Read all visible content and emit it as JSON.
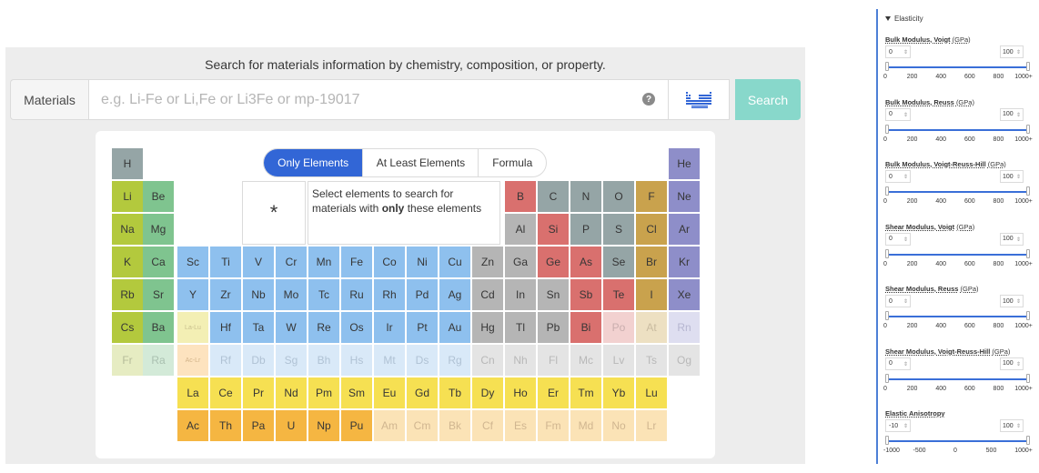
{
  "search": {
    "headline": "Search for materials information by chemistry, composition, or property.",
    "label": "Materials",
    "placeholder": "e.g. Li-Fe or Li,Fe or Li3Fe or mp-19017",
    "help": "?",
    "button": "Search",
    "periodic_table_icon": "periodic-table-icon"
  },
  "modes": [
    "Only Elements",
    "At Least Elements",
    "Formula"
  ],
  "active_mode": "Only Elements",
  "selection_box": {
    "wildcard": "*",
    "hint_prefix": "Select elements to search for materials with ",
    "hint_bold": "only",
    "hint_suffix": " these elements"
  },
  "colors": {
    "accent": "#3266d6",
    "search_button": "#88d8cb",
    "slider": "#3a6fd8"
  },
  "elements": [
    [
      "H",
      0,
      0,
      "#95a5a6",
      "#363636"
    ],
    [
      "He",
      17,
      0,
      "#8e8ec9",
      "#363636"
    ],
    [
      "Li",
      0,
      1,
      "#b3c93d",
      "#363636"
    ],
    [
      "Be",
      1,
      1,
      "#7fc48f",
      "#363636"
    ],
    [
      "B",
      12,
      1,
      "#d9706e",
      "#363636"
    ],
    [
      "C",
      13,
      1,
      "#95a5a6",
      "#363636"
    ],
    [
      "N",
      14,
      1,
      "#95a5a6",
      "#363636"
    ],
    [
      "O",
      15,
      1,
      "#95a5a6",
      "#363636"
    ],
    [
      "F",
      16,
      1,
      "#c9a24d",
      "#363636"
    ],
    [
      "Ne",
      17,
      1,
      "#8e8ec9",
      "#363636"
    ],
    [
      "Na",
      0,
      2,
      "#b3c93d",
      "#363636"
    ],
    [
      "Mg",
      1,
      2,
      "#7fc48f",
      "#363636"
    ],
    [
      "Al",
      12,
      2,
      "#b5b5b5",
      "#363636"
    ],
    [
      "Si",
      13,
      2,
      "#d9706e",
      "#363636"
    ],
    [
      "P",
      14,
      2,
      "#95a5a6",
      "#363636"
    ],
    [
      "S",
      15,
      2,
      "#95a5a6",
      "#363636"
    ],
    [
      "Cl",
      16,
      2,
      "#c9a24d",
      "#363636"
    ],
    [
      "Ar",
      17,
      2,
      "#8e8ec9",
      "#363636"
    ],
    [
      "K",
      0,
      3,
      "#b3c93d",
      "#363636"
    ],
    [
      "Ca",
      1,
      3,
      "#7fc48f",
      "#363636"
    ],
    [
      "Sc",
      2,
      3,
      "#8ec0ee",
      "#363636"
    ],
    [
      "Ti",
      3,
      3,
      "#8ec0ee",
      "#363636"
    ],
    [
      "V",
      4,
      3,
      "#8ec0ee",
      "#363636"
    ],
    [
      "Cr",
      5,
      3,
      "#8ec0ee",
      "#363636"
    ],
    [
      "Mn",
      6,
      3,
      "#8ec0ee",
      "#363636"
    ],
    [
      "Fe",
      7,
      3,
      "#8ec0ee",
      "#363636"
    ],
    [
      "Co",
      8,
      3,
      "#8ec0ee",
      "#363636"
    ],
    [
      "Ni",
      9,
      3,
      "#8ec0ee",
      "#363636"
    ],
    [
      "Cu",
      10,
      3,
      "#8ec0ee",
      "#363636"
    ],
    [
      "Zn",
      11,
      3,
      "#b5b5b5",
      "#363636"
    ],
    [
      "Ga",
      12,
      3,
      "#b5b5b5",
      "#363636"
    ],
    [
      "Ge",
      13,
      3,
      "#d9706e",
      "#363636"
    ],
    [
      "As",
      14,
      3,
      "#d9706e",
      "#363636"
    ],
    [
      "Se",
      15,
      3,
      "#95a5a6",
      "#363636"
    ],
    [
      "Br",
      16,
      3,
      "#c9a24d",
      "#363636"
    ],
    [
      "Kr",
      17,
      3,
      "#8e8ec9",
      "#363636"
    ],
    [
      "Rb",
      0,
      4,
      "#b3c93d",
      "#363636"
    ],
    [
      "Sr",
      1,
      4,
      "#7fc48f",
      "#363636"
    ],
    [
      "Y",
      2,
      4,
      "#8ec0ee",
      "#363636"
    ],
    [
      "Zr",
      3,
      4,
      "#8ec0ee",
      "#363636"
    ],
    [
      "Nb",
      4,
      4,
      "#8ec0ee",
      "#363636"
    ],
    [
      "Mo",
      5,
      4,
      "#8ec0ee",
      "#363636"
    ],
    [
      "Tc",
      6,
      4,
      "#8ec0ee",
      "#363636"
    ],
    [
      "Ru",
      7,
      4,
      "#8ec0ee",
      "#363636"
    ],
    [
      "Rh",
      8,
      4,
      "#8ec0ee",
      "#363636"
    ],
    [
      "Pd",
      9,
      4,
      "#8ec0ee",
      "#363636"
    ],
    [
      "Ag",
      10,
      4,
      "#8ec0ee",
      "#363636"
    ],
    [
      "Cd",
      11,
      4,
      "#b5b5b5",
      "#363636"
    ],
    [
      "In",
      12,
      4,
      "#b5b5b5",
      "#363636"
    ],
    [
      "Sn",
      13,
      4,
      "#b5b5b5",
      "#363636"
    ],
    [
      "Sb",
      14,
      4,
      "#d9706e",
      "#363636"
    ],
    [
      "Te",
      15,
      4,
      "#d9706e",
      "#363636"
    ],
    [
      "I",
      16,
      4,
      "#c9a24d",
      "#363636"
    ],
    [
      "Xe",
      17,
      4,
      "#8e8ec9",
      "#363636"
    ],
    [
      "Cs",
      0,
      5,
      "#b3c93d",
      "#363636"
    ],
    [
      "Ba",
      1,
      5,
      "#7fc48f",
      "#363636"
    ],
    [
      "La-Lu",
      2,
      5,
      "#f3efb4",
      "#c9c08e"
    ],
    [
      "Hf",
      3,
      5,
      "#8ec0ee",
      "#363636"
    ],
    [
      "Ta",
      4,
      5,
      "#8ec0ee",
      "#363636"
    ],
    [
      "W",
      5,
      5,
      "#8ec0ee",
      "#363636"
    ],
    [
      "Re",
      6,
      5,
      "#8ec0ee",
      "#363636"
    ],
    [
      "Os",
      7,
      5,
      "#8ec0ee",
      "#363636"
    ],
    [
      "Ir",
      8,
      5,
      "#8ec0ee",
      "#363636"
    ],
    [
      "Pt",
      9,
      5,
      "#8ec0ee",
      "#363636"
    ],
    [
      "Au",
      10,
      5,
      "#8ec0ee",
      "#363636"
    ],
    [
      "Hg",
      11,
      5,
      "#b5b5b5",
      "#363636"
    ],
    [
      "Tl",
      12,
      5,
      "#b5b5b5",
      "#363636"
    ],
    [
      "Pb",
      13,
      5,
      "#b5b5b5",
      "#363636"
    ],
    [
      "Bi",
      14,
      5,
      "#d9706e",
      "#363636"
    ],
    [
      "Po",
      15,
      5,
      "#f2d1d0",
      "#c9aeae"
    ],
    [
      "At",
      16,
      5,
      "#ede0c2",
      "#c9bba0"
    ],
    [
      "Rn",
      17,
      5,
      "#dedef0",
      "#b6b6d0"
    ],
    [
      "Fr",
      0,
      6,
      "#e6ecc2",
      "#b6bc9a"
    ],
    [
      "Ra",
      1,
      6,
      "#d3ead8",
      "#aac0b0"
    ],
    [
      "Ac-Lr",
      2,
      6,
      "#fde3bf",
      "#d2b48a"
    ],
    [
      "Rf",
      3,
      6,
      "#d9e9f8",
      "#b0c2d4"
    ],
    [
      "Db",
      4,
      6,
      "#d9e9f8",
      "#b0c2d4"
    ],
    [
      "Sg",
      5,
      6,
      "#d9e9f8",
      "#b0c2d4"
    ],
    [
      "Bh",
      6,
      6,
      "#d9e9f8",
      "#b0c2d4"
    ],
    [
      "Hs",
      7,
      6,
      "#d9e9f8",
      "#b0c2d4"
    ],
    [
      "Mt",
      8,
      6,
      "#d9e9f8",
      "#b0c2d4"
    ],
    [
      "Ds",
      9,
      6,
      "#d9e9f8",
      "#b0c2d4"
    ],
    [
      "Rg",
      10,
      6,
      "#d9e9f8",
      "#b0c2d4"
    ],
    [
      "Cn",
      11,
      6,
      "#e4e4e4",
      "#b8b8b8"
    ],
    [
      "Nh",
      12,
      6,
      "#e4e4e4",
      "#b8b8b8"
    ],
    [
      "Fl",
      13,
      6,
      "#e4e4e4",
      "#b8b8b8"
    ],
    [
      "Mc",
      14,
      6,
      "#e4e4e4",
      "#b8b8b8"
    ],
    [
      "Lv",
      15,
      6,
      "#e4e4e4",
      "#b8b8b8"
    ],
    [
      "Ts",
      16,
      6,
      "#e4e4e4",
      "#b8b8b8"
    ],
    [
      "Og",
      17,
      6,
      "#e4e4e4",
      "#b8b8b8"
    ],
    [
      "La",
      2,
      7,
      "#f6e052",
      "#363636"
    ],
    [
      "Ce",
      3,
      7,
      "#f6e052",
      "#363636"
    ],
    [
      "Pr",
      4,
      7,
      "#f6e052",
      "#363636"
    ],
    [
      "Nd",
      5,
      7,
      "#f6e052",
      "#363636"
    ],
    [
      "Pm",
      6,
      7,
      "#f6e052",
      "#363636"
    ],
    [
      "Sm",
      7,
      7,
      "#f6e052",
      "#363636"
    ],
    [
      "Eu",
      8,
      7,
      "#f6e052",
      "#363636"
    ],
    [
      "Gd",
      9,
      7,
      "#f6e052",
      "#363636"
    ],
    [
      "Tb",
      10,
      7,
      "#f6e052",
      "#363636"
    ],
    [
      "Dy",
      11,
      7,
      "#f6e052",
      "#363636"
    ],
    [
      "Ho",
      12,
      7,
      "#f6e052",
      "#363636"
    ],
    [
      "Er",
      13,
      7,
      "#f6e052",
      "#363636"
    ],
    [
      "Tm",
      14,
      7,
      "#f6e052",
      "#363636"
    ],
    [
      "Yb",
      15,
      7,
      "#f6e052",
      "#363636"
    ],
    [
      "Lu",
      16,
      7,
      "#f6e052",
      "#363636"
    ],
    [
      "Ac",
      2,
      8,
      "#f5b642",
      "#363636"
    ],
    [
      "Th",
      3,
      8,
      "#f5b642",
      "#363636"
    ],
    [
      "Pa",
      4,
      8,
      "#f5b642",
      "#363636"
    ],
    [
      "U",
      5,
      8,
      "#f5b642",
      "#363636"
    ],
    [
      "Np",
      6,
      8,
      "#f5b642",
      "#363636"
    ],
    [
      "Pu",
      7,
      8,
      "#f5b642",
      "#363636"
    ],
    [
      "Am",
      8,
      8,
      "#fbe3b6",
      "#d0b690"
    ],
    [
      "Cm",
      9,
      8,
      "#fbe3b6",
      "#d0b690"
    ],
    [
      "Bk",
      10,
      8,
      "#fbe3b6",
      "#d0b690"
    ],
    [
      "Cf",
      11,
      8,
      "#fbe3b6",
      "#d0b690"
    ],
    [
      "Es",
      12,
      8,
      "#fbe3b6",
      "#d0b690"
    ],
    [
      "Fm",
      13,
      8,
      "#fbe3b6",
      "#d0b690"
    ],
    [
      "Md",
      14,
      8,
      "#fbe3b6",
      "#d0b690"
    ],
    [
      "No",
      15,
      8,
      "#fbe3b6",
      "#d0b690"
    ],
    [
      "Lr",
      16,
      8,
      "#fbe3b6",
      "#d0b690"
    ]
  ],
  "filters": {
    "section": "Elasticity",
    "properties": [
      {
        "name": "Bulk Modulus, Voigt",
        "unit": "(GPa)",
        "min": "0",
        "max": "100",
        "ticks": [
          "0",
          "200",
          "400",
          "600",
          "800",
          "1000+"
        ]
      },
      {
        "name": "Bulk Modulus, Reuss",
        "unit": "(GPa)",
        "min": "0",
        "max": "100",
        "ticks": [
          "0",
          "200",
          "400",
          "600",
          "800",
          "1000+"
        ]
      },
      {
        "name": "Bulk Modulus, Voigt-Reuss-Hill",
        "unit": "(GPa)",
        "min": "0",
        "max": "100",
        "ticks": [
          "0",
          "200",
          "400",
          "600",
          "800",
          "1000+"
        ]
      },
      {
        "name": "Shear Modulus, Voigt",
        "unit": "(GPa)",
        "min": "0",
        "max": "100",
        "ticks": [
          "0",
          "200",
          "400",
          "600",
          "800",
          "1000+"
        ]
      },
      {
        "name": "Shear Modulus, Reuss",
        "unit": "(GPa)",
        "min": "0",
        "max": "100",
        "ticks": [
          "0",
          "200",
          "400",
          "600",
          "800",
          "1000+"
        ]
      },
      {
        "name": "Shear Modulus, Voigt-Reuss-Hill",
        "unit": "(GPa)",
        "min": "0",
        "max": "100",
        "ticks": [
          "0",
          "200",
          "400",
          "600",
          "800",
          "1000+"
        ]
      },
      {
        "name": "Elastic Anisotropy",
        "unit": "",
        "min": "-10",
        "max": "100",
        "ticks": [
          "-1000",
          "-500",
          "0",
          "500",
          "1000+"
        ]
      }
    ]
  }
}
